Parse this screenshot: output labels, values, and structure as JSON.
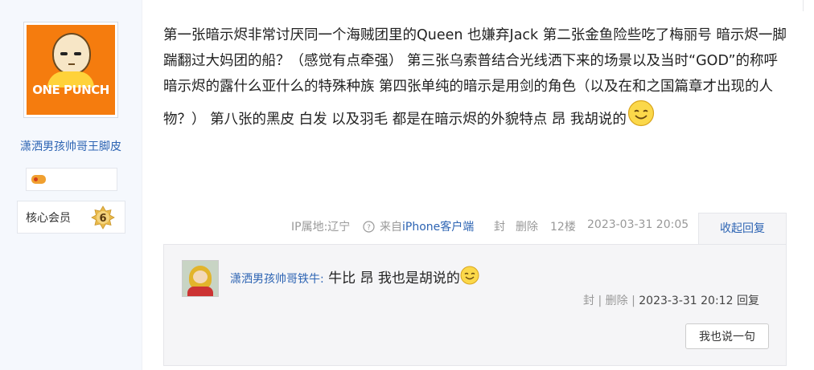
{
  "author": {
    "avatar_text": "ONE PUNCH",
    "name": "潇洒男孩帅哥王脚皮",
    "member_label": "核心会员",
    "member_level": "6"
  },
  "post": {
    "text": "第一张暗示烬非常讨厌同一个海贼团里的Queen 也嫌弃Jack 第二张金鱼险些吃了梅丽号 暗示烬一脚踹翻过大妈团的船？（感觉有点牵强） 第三张乌索普结合光线洒下来的场景以及当时“GOD”的称呼 暗示烬的露什么亚什么的特殊种族 第四张单纯的暗示是用剑的角色（以及在和之国篇章才出现的人物？） 第八张的黑皮 白发 以及羽毛 都是在暗示烬的外貌特点 昂 我胡说的",
    "ip_label": "IP属地:辽宁",
    "source_prefix": "来自",
    "source_client": "iPhone客户端",
    "ban_label": "封",
    "delete_label": "删除",
    "floor": "12楼",
    "time": "2023-03-31 20:05",
    "collapse_label": "收起回复"
  },
  "reply": {
    "user": "潇洒男孩帅哥铁牛:",
    "text": " 牛比 昂 我也是胡说的",
    "ban_label": "封",
    "sep": "|",
    "delete_label": "删除",
    "time": "2023-3-31 20:12",
    "reply_label": "回复",
    "add_label": "我也说一句"
  },
  "colors": {
    "link_blue": "#2d64b3",
    "avatar_orange": "#f57c0e",
    "sidebar_bg": "#f5f8fd"
  }
}
